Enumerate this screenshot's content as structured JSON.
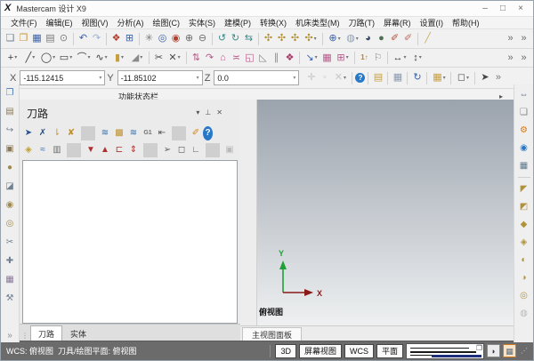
{
  "window": {
    "logo": "X",
    "title": "Mastercam 设计 X9",
    "minimize": "–",
    "maximize": "□",
    "close": "×"
  },
  "menu": {
    "items": [
      {
        "t": "文件(F)",
        "n": "menu-file"
      },
      {
        "t": "编辑(E)",
        "n": "menu-edit"
      },
      {
        "t": "视图(V)",
        "n": "menu-view"
      },
      {
        "t": "分析(A)",
        "n": "menu-analyze"
      },
      {
        "t": "绘图(C)",
        "n": "menu-create"
      },
      {
        "t": "实体(S)",
        "n": "menu-solids"
      },
      {
        "t": "建模(P)",
        "n": "menu-model"
      },
      {
        "t": "转换(X)",
        "n": "menu-xform"
      },
      {
        "t": "机床类型(M)",
        "n": "menu-machine-type"
      },
      {
        "t": "刀路(T)",
        "n": "menu-toolpaths"
      },
      {
        "t": "屏幕(R)",
        "n": "menu-screen"
      },
      {
        "t": "设置(I)",
        "n": "menu-settings"
      },
      {
        "t": "帮助(H)",
        "n": "menu-help"
      }
    ]
  },
  "toolbar1": {
    "items": [
      {
        "t": "❏",
        "c": "#6f7f96",
        "n": "new-file-icon"
      },
      {
        "t": "❒",
        "c": "#c7973f",
        "n": "open-file-icon"
      },
      {
        "t": "▦",
        "c": "#3a62a8",
        "n": "save-icon"
      },
      {
        "t": "▤",
        "c": "#7a7a7a",
        "n": "print-icon"
      },
      {
        "t": "⊙",
        "c": "#7a7a7a",
        "n": "print-preview-icon"
      },
      {
        "t": "",
        "cls": "sep",
        "n": "separator",
        "i": false
      },
      {
        "t": "↶",
        "c": "#3a62a8",
        "n": "undo-icon"
      },
      {
        "t": "↷",
        "c": "#9ab0d0",
        "n": "redo-icon"
      },
      {
        "t": "",
        "cls": "sep",
        "n": "separator",
        "i": false
      },
      {
        "t": "❖",
        "c": "#b04030",
        "n": "fit-screen-icon"
      },
      {
        "t": "⊞",
        "c": "#3a62a8",
        "n": "repaint-icon"
      },
      {
        "t": "",
        "cls": "sep",
        "n": "separator",
        "i": false
      },
      {
        "t": "✳",
        "c": "#7a7a7a",
        "n": "zoom-dynamic-icon"
      },
      {
        "t": "◎",
        "c": "#3a62a8",
        "n": "zoom-window-icon"
      },
      {
        "t": "◉",
        "c": "#b04030",
        "n": "zoom-target-icon"
      },
      {
        "t": "⊕",
        "c": "#6a6a6a",
        "n": "zoom-in-icon"
      },
      {
        "t": "⊖",
        "c": "#6a6a6a",
        "n": "zoom-out-icon"
      },
      {
        "t": "",
        "cls": "sep",
        "n": "separator",
        "i": false
      },
      {
        "t": "↺",
        "c": "#3a8a8a",
        "n": "dynamic-rotate-icon"
      },
      {
        "t": "↻",
        "c": "#3a8a8a",
        "n": "pan-icon"
      },
      {
        "t": "⇆",
        "c": "#3a8a8a",
        "n": "view-orient-icon"
      },
      {
        "t": "",
        "cls": "sep",
        "n": "separator",
        "i": false
      },
      {
        "t": "✣",
        "c": "#b09030",
        "n": "gnomon-top-icon"
      },
      {
        "t": "✣",
        "c": "#b09030",
        "n": "gnomon-front-icon"
      },
      {
        "t": "✣",
        "c": "#b09030",
        "n": "gnomon-side-icon"
      },
      {
        "t": "✣",
        "c": "#b09030",
        "cls": "dd",
        "n": "gnomon-iso-icon"
      },
      {
        "t": "",
        "cls": "sep",
        "n": "separator",
        "i": false
      },
      {
        "t": "⊕",
        "c": "#3a62a8",
        "cls": "dd",
        "n": "wireframe-view-icon"
      },
      {
        "t": "◍",
        "c": "#8fa0b8",
        "cls": "dd",
        "n": "translucent-view-icon"
      },
      {
        "t": "◕",
        "c": "#3a4a66",
        "n": "shaded-view-icon"
      },
      {
        "t": "●",
        "c": "#4a7050",
        "n": "shaded-edges-view-icon"
      },
      {
        "t": "✐",
        "c": "#b05040",
        "n": "material-render-icon"
      },
      {
        "t": "✐",
        "c": "#c07060",
        "n": "material-render-alt-icon"
      },
      {
        "t": "",
        "cls": "sep",
        "n": "separator",
        "i": false
      },
      {
        "t": "╱",
        "c": "#c2b45c",
        "n": "pencil-line-icon"
      },
      {
        "t": "»",
        "c": "#6a6a6a",
        "cls": "pushR",
        "n": "toolbar-overflow-icon"
      },
      {
        "t": "»",
        "c": "#6a6a6a",
        "n": "toolbar-overflow2-icon"
      }
    ]
  },
  "toolbar2": {
    "items": [
      {
        "t": "+",
        "c": "#3a3a3a",
        "cls": "dd",
        "n": "point-icon"
      },
      {
        "t": "╱",
        "c": "#3a3a3a",
        "cls": "dd",
        "n": "line-icon"
      },
      {
        "t": "◯",
        "c": "#3a3a3a",
        "cls": "dd",
        "n": "arc-icon"
      },
      {
        "t": "▭",
        "c": "#3a3a3a",
        "cls": "dd",
        "n": "rectangle-icon"
      },
      {
        "t": "⌒",
        "c": "#3a3a3a",
        "cls": "dd",
        "n": "fillet-icon"
      },
      {
        "t": "∿",
        "c": "#3a3a3a",
        "cls": "dd",
        "n": "spline-icon"
      },
      {
        "t": "▮",
        "c": "#c79f3f",
        "cls": "dd",
        "n": "solid-icon"
      },
      {
        "t": "◢",
        "c": "#8a8a8a",
        "cls": "dd",
        "n": "chamfer-icon"
      },
      {
        "t": "",
        "cls": "sep",
        "n": "separator",
        "i": false
      },
      {
        "t": "✂",
        "c": "#4a4a4a",
        "n": "trim-icon"
      },
      {
        "t": "✕",
        "c": "#4a4a4a",
        "cls": "dd",
        "n": "break-icon"
      },
      {
        "t": "",
        "cls": "sep",
        "n": "separator",
        "i": false
      },
      {
        "t": "⇅",
        "c": "#b85a8a",
        "n": "xform-translate-icon"
      },
      {
        "t": "↷",
        "c": "#b85a8a",
        "n": "xform-rotate-icon"
      },
      {
        "t": "⌂",
        "c": "#b85a8a",
        "n": "xform-offset-icon"
      },
      {
        "t": "≍",
        "c": "#b85a8a",
        "n": "xform-project-icon"
      },
      {
        "t": "◱",
        "c": "#b85a8a",
        "n": "xform-scale-icon"
      },
      {
        "t": "◺",
        "c": "#8a8a8a",
        "n": "xform-mirror-icon"
      },
      {
        "t": "∥",
        "c": "#8a8a8a",
        "n": "xform-array-icon"
      },
      {
        "t": "❖",
        "c": "#a83a6a",
        "n": "dynamic-xform-icon"
      },
      {
        "t": "",
        "cls": "sep",
        "n": "separator",
        "i": false
      },
      {
        "t": "↘",
        "c": "#3a62a8",
        "cls": "dd",
        "n": "move-to-origin-icon"
      },
      {
        "t": "▦",
        "c": "#b85a8a",
        "n": "rect-array-icon"
      },
      {
        "t": "⊞",
        "c": "#b85a8a",
        "cls": "dd",
        "n": "nesting-icon"
      },
      {
        "t": "",
        "cls": "sep",
        "n": "separator",
        "i": false
      },
      {
        "t": "1↑",
        "c": "#c08030",
        "cls": "txt",
        "n": "renumber-icon"
      },
      {
        "t": "⚐",
        "c": "#8a8a8a",
        "n": "note-icon"
      },
      {
        "t": "",
        "cls": "sep",
        "n": "separator",
        "i": false
      },
      {
        "t": "↔",
        "c": "#3a3a3a",
        "cls": "dd",
        "n": "dim-horizontal-icon"
      },
      {
        "t": "↕",
        "c": "#3a3a3a",
        "cls": "dd",
        "n": "dim-vertical-icon"
      },
      {
        "t": "»",
        "c": "#6a6a6a",
        "cls": "pushR",
        "n": "toolbar2-overflow-icon"
      },
      {
        "t": "»",
        "c": "#6a6a6a",
        "n": "toolbar2-overflow2-icon"
      }
    ]
  },
  "coords": {
    "x_label": "X",
    "x_value": "-115.12415",
    "y_label": "Y",
    "y_value": "-11.85102",
    "z_label": "Z",
    "z_value": "0.0",
    "dd": "▾",
    "icons": [
      {
        "t": "✛",
        "c": "#c4c4c4",
        "n": "autocursor-icon"
      },
      {
        "t": "◦",
        "c": "#c4c4c4",
        "n": "cursor-point-icon"
      },
      {
        "t": "✕",
        "c": "#c8c8c8",
        "cls": "dd",
        "n": "clear-entry-icon"
      },
      {
        "t": "",
        "cls": "sep",
        "n": "separator",
        "i": false
      },
      {
        "t": "?",
        "cls": "badge",
        "n": "help-icon"
      },
      {
        "t": "",
        "cls": "sep",
        "n": "separator",
        "i": false
      },
      {
        "t": "▤",
        "c": "#c79f3f",
        "n": "copy-attributes-icon"
      },
      {
        "t": "",
        "cls": "sep",
        "n": "separator",
        "i": false
      },
      {
        "t": "▦",
        "c": "#8a9ab0",
        "n": "match-attributes-icon"
      },
      {
        "t": "",
        "cls": "sep",
        "n": "separator",
        "i": false
      },
      {
        "t": "↻",
        "c": "#3a62a8",
        "n": "regenerate-icon"
      },
      {
        "t": "",
        "cls": "sep",
        "n": "separator",
        "i": false
      },
      {
        "t": "▦",
        "c": "#c79f3f",
        "cls": "dd",
        "n": "grid-settings-icon"
      },
      {
        "t": "",
        "cls": "sep",
        "n": "separator",
        "i": false
      },
      {
        "t": "◻",
        "c": "#555555",
        "cls": "dd",
        "n": "selection-window-icon"
      },
      {
        "t": "",
        "cls": "sep",
        "n": "separator",
        "i": false
      },
      {
        "t": "➤",
        "c": "#444444",
        "n": "select-cursor-icon"
      },
      {
        "t": "»",
        "c": "#777777",
        "n": "coord-overflow-icon"
      }
    ]
  },
  "ribbon": {
    "label": "功能状态栏",
    "arrow": "▸"
  },
  "left_strip": {
    "items": [
      {
        "t": "❐",
        "c": "#4a78b0",
        "n": "machine-properties-icon"
      },
      {
        "t": "▤",
        "c": "#8a7a5a",
        "n": "stock-setup-icon"
      },
      {
        "t": "↪",
        "c": "#708090",
        "n": "chain-icon"
      },
      {
        "t": "▣",
        "c": "#8a7a5a",
        "n": "tool-settings-icon"
      },
      {
        "t": "●",
        "c": "#a08a50",
        "n": "material-icon"
      },
      {
        "t": "◪",
        "c": "#708090",
        "n": "stock-model-icon"
      },
      {
        "t": "◉",
        "c": "#a08a50",
        "n": "mill-tool-icon"
      },
      {
        "t": "◎",
        "c": "#a08a50",
        "n": "lathe-tool-icon"
      },
      {
        "t": "✂",
        "c": "#708090",
        "n": "wire-icon"
      },
      {
        "t": "✚",
        "c": "#708090",
        "n": "add-tool-icon"
      },
      {
        "t": "▦",
        "c": "#8a7a9a",
        "n": "tool-library-icon"
      },
      {
        "t": "⚒",
        "c": "#708090",
        "n": "machine-sim-icon"
      },
      {
        "t": "»",
        "c": "#8a8a8a",
        "cls": "pushB",
        "n": "left-strip-overflow-icon"
      }
    ]
  },
  "right_strip": {
    "items": [
      {
        "t": "⇔",
        "c": "#607080",
        "n": "fit-window-icon"
      },
      {
        "t": "❏",
        "c": "#808080",
        "n": "new-window-icon"
      },
      {
        "t": "⚙",
        "c": "#d07820",
        "n": "gear-icon"
      },
      {
        "t": "◉",
        "c": "#2878c8",
        "n": "info-icon"
      },
      {
        "t": "▦",
        "c": "#607a8a",
        "n": "display-options-icon"
      },
      {
        "t": "",
        "cls": "hsep",
        "n": "separator",
        "i": false
      },
      {
        "t": "◤",
        "c": "#b0923a",
        "n": "surface-flowline-icon"
      },
      {
        "t": "◩",
        "c": "#b0923a",
        "n": "surface-net-icon"
      },
      {
        "t": "◆",
        "c": "#b0923a",
        "n": "surface-fence-icon"
      },
      {
        "t": "◈",
        "c": "#b0923a",
        "n": "surface-draft-icon"
      },
      {
        "t": "◐",
        "c": "#b0923a",
        "n": "surface-extrude-icon"
      },
      {
        "t": "◑",
        "c": "#b0923a",
        "n": "surface-revolve-icon"
      },
      {
        "t": "◎",
        "c": "#b0923a",
        "n": "surface-sweep-icon"
      },
      {
        "t": "◍",
        "c": "#bbbbbb",
        "n": "surface-disabled-icon"
      }
    ]
  },
  "toolpath_panel": {
    "title": "刀路",
    "grip": "⋮",
    "header_icons": [
      {
        "t": "▾",
        "n": "panel-menu-icon"
      },
      {
        "t": "⊥",
        "n": "panel-pin-icon"
      },
      {
        "t": "✕",
        "n": "panel-close-icon"
      }
    ],
    "row1": [
      {
        "t": "➤",
        "c": "#28508c",
        "n": "select-all-operations-icon"
      },
      {
        "t": "✗",
        "c": "#28508c",
        "n": "deselect-all-operations-icon"
      },
      {
        "t": "⇂",
        "c": "#c09030",
        "n": "select-tool-ops-icon"
      },
      {
        "t": "✘",
        "c": "#c09030",
        "n": "deselect-tool-ops-icon"
      },
      {
        "t": "",
        "cls": "sep",
        "n": "separator",
        "i": false
      },
      {
        "t": "≋",
        "c": "#2868b0",
        "n": "regen-all-icon"
      },
      {
        "t": "▩",
        "c": "#c09030",
        "n": "copy-operations-icon"
      },
      {
        "t": "≋",
        "c": "#2868b0",
        "n": "regen-selected-icon"
      },
      {
        "t": "G1",
        "c": "#707070",
        "cls": "txt",
        "n": "g1-post-icon"
      },
      {
        "t": "⇤",
        "c": "#505050",
        "n": "backplot-icon"
      },
      {
        "t": "",
        "cls": "sep",
        "n": "separator",
        "i": false
      },
      {
        "t": "✐",
        "c": "#d08820",
        "n": "verify-icon"
      },
      {
        "t": "?",
        "cls": "badge",
        "n": "help-icon"
      }
    ],
    "row2": [
      {
        "t": "◈",
        "c": "#c0a030",
        "n": "lock-icon"
      },
      {
        "t": "≈",
        "c": "#2868b0",
        "n": "toggle-toolpath-display-icon"
      },
      {
        "t": "▥",
        "c": "#707070",
        "n": "filter-icon"
      },
      {
        "t": "",
        "cls": "sep",
        "n": "separator",
        "i": false
      },
      {
        "t": "▼",
        "c": "#b03030",
        "n": "move-down-icon"
      },
      {
        "t": "▲",
        "c": "#b03030",
        "n": "move-up-icon"
      },
      {
        "t": "⊏",
        "c": "#b03030",
        "n": "insert-arrow-icon"
      },
      {
        "t": "⇕",
        "c": "#b03030",
        "n": "scroll-insert-icon"
      },
      {
        "t": "",
        "cls": "sep",
        "n": "separator",
        "i": false
      },
      {
        "t": "➢",
        "c": "#606060",
        "n": "select-associated-icon"
      },
      {
        "t": "◻",
        "c": "#606060",
        "n": "select-window-icon"
      },
      {
        "t": "∟",
        "c": "#606060",
        "n": "geometry-icon"
      },
      {
        "t": "",
        "cls": "sep",
        "n": "separator",
        "i": false
      },
      {
        "t": "▣",
        "c": "#bbbbbb",
        "n": "disabled-option-icon"
      },
      {
        "t": "◉",
        "c": "#bbbbbb",
        "n": "disabled-option2-icon"
      }
    ],
    "tabs": [
      {
        "t": "刀路",
        "cls": "active",
        "n": "tab-toolpaths"
      },
      {
        "t": "实体",
        "n": "tab-solids"
      }
    ]
  },
  "viewport": {
    "view_label": "俯视图",
    "tab": "主视图面板",
    "gizmo": {
      "x": "X",
      "y": "Y",
      "xc": "#8a1a1a",
      "yc": "#22a038"
    }
  },
  "status_bar": {
    "text": "WCS: 俯视图  刀具/绘图平面: 俯视图",
    "buttons": [
      {
        "t": "3D",
        "n": "gview-3d-button"
      },
      {
        "t": "屏幕视图",
        "n": "screen-view-button"
      },
      {
        "t": "WCS",
        "n": "wcs-button"
      },
      {
        "t": "平面",
        "n": "planes-button"
      }
    ],
    "widget_icon": "❐",
    "shade_glyph": "◗",
    "axes_glyph": "▦",
    "grip": "⋰"
  },
  "colors": {
    "viewport_top": "#9ba3ad",
    "viewport_bottom": "#eef0f1",
    "statusbar": "#6b6b6b",
    "axis_x": "#8a1a1a",
    "axis_y": "#22a038",
    "help_badge": "#2878c8"
  }
}
